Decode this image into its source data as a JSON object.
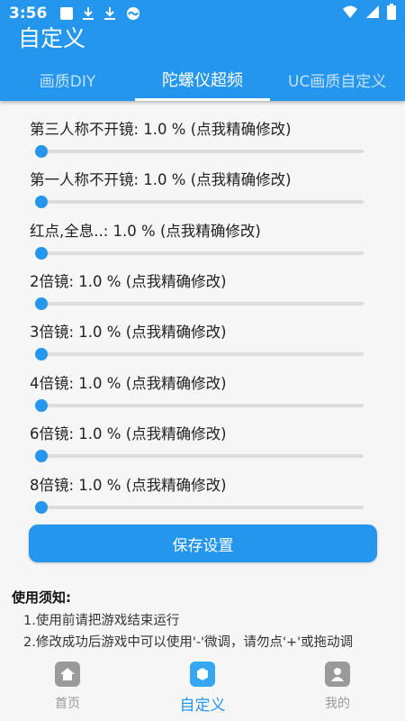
{
  "status_bar": {
    "time": "3:56",
    "icons": [
      "square-icon",
      "download-icon",
      "download-icon",
      "cloud-icon"
    ],
    "right_icons": [
      "wifi-icon",
      "signal-icon",
      "battery-icon"
    ]
  },
  "header": {
    "title": "自定义",
    "tabs": [
      {
        "label": "画质DIY",
        "active": false
      },
      {
        "label": "陀螺仪超频",
        "active": true
      },
      {
        "label": "UC画质自定义",
        "active": false
      }
    ]
  },
  "settings": [
    {
      "label": "第三人称不开镜:  1.0 %  (点我精确修改)",
      "value_fraction": 0.0
    },
    {
      "label": "第一人称不开镜:  1.0 %  (点我精确修改)",
      "value_fraction": 0.0
    },
    {
      "label": "红点,全息..:  1.0 %  (点我精确修改)",
      "value_fraction": 0.0
    },
    {
      "label": "2倍镜:  1.0 %  (点我精确修改)",
      "value_fraction": 0.0
    },
    {
      "label": "3倍镜:  1.0 %  (点我精确修改)",
      "value_fraction": 0.0
    },
    {
      "label": "4倍镜:  1.0 %  (点我精确修改)",
      "value_fraction": 0.0
    },
    {
      "label": "6倍镜:  1.0 %  (点我精确修改)",
      "value_fraction": 0.0
    },
    {
      "label": "8倍镜:  1.0 %  (点我精确修改)",
      "value_fraction": 0.0
    }
  ],
  "save_button": "保存设置",
  "notice": {
    "title": "使用须知:",
    "items": [
      "1.使用前请把游戏结束运行",
      "2.修改成功后游戏中可以使用'-'微调，请勿点'+'或拖动调"
    ]
  },
  "bottom_nav": [
    {
      "label": "首页",
      "icon": "home-icon",
      "active": false
    },
    {
      "label": "自定义",
      "icon": "custom-icon",
      "active": true
    },
    {
      "label": "我的",
      "icon": "profile-icon",
      "active": false
    }
  ],
  "colors": {
    "accent": "#2596ee",
    "background": "#f6f6f6",
    "inactive": "#9a9a9a"
  }
}
